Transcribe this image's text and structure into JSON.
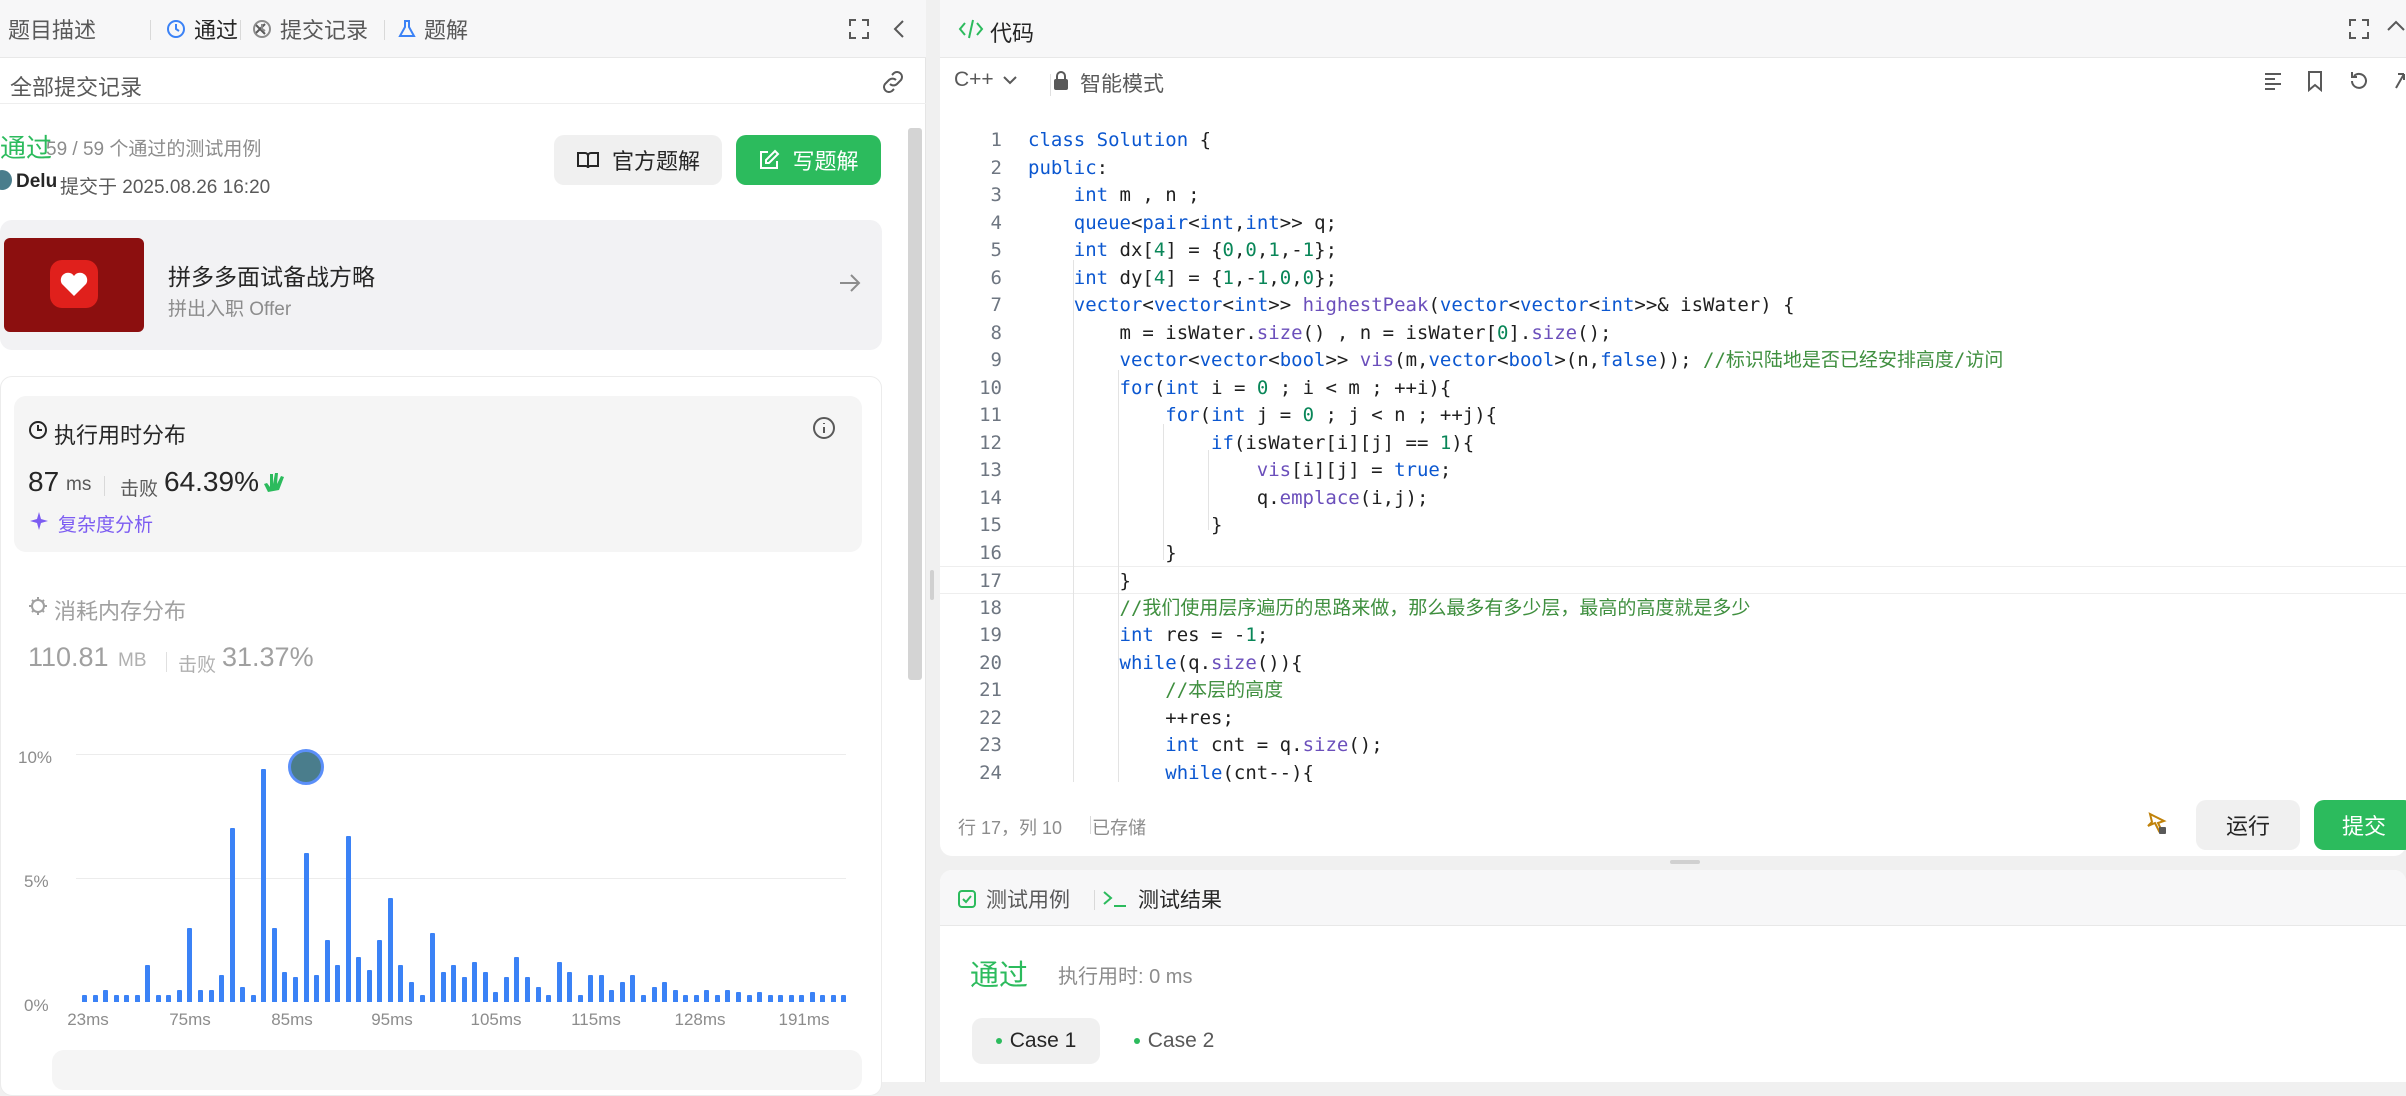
{
  "left_tabs": {
    "description": "题目描述",
    "accepted": "通过",
    "submissions": "提交记录",
    "solutions": "题解"
  },
  "sub_header": {
    "title": "全部提交记录"
  },
  "result": {
    "status": "通过",
    "cases": "59 / 59 个通过的测试用例",
    "user": "Delu",
    "submitted_at": "提交于 2025.08.26 16:20",
    "official_btn": "官方题解",
    "write_btn": "写题解"
  },
  "promo": {
    "title": "拼多多面试备战方略",
    "subtitle": "拼出入职 Offer"
  },
  "runtime": {
    "title": "执行用时分布",
    "value": "87",
    "unit": "ms",
    "beats_label": "击败",
    "beats": "64.39%",
    "complexity": "复杂度分析"
  },
  "memory": {
    "title": "消耗内存分布",
    "value": "110.81",
    "unit": "MB",
    "beats_label": "击败",
    "beats": "31.37%"
  },
  "chart_data": {
    "type": "bar",
    "ylabels": [
      "10%",
      "5%",
      "0%"
    ],
    "ylim": [
      0,
      10
    ],
    "xlabels": [
      "23ms",
      "75ms",
      "85ms",
      "95ms",
      "105ms",
      "115ms",
      "128ms",
      "191ms"
    ],
    "values": [
      0.3,
      0.3,
      0.5,
      0.3,
      0.3,
      0.3,
      1.5,
      0.3,
      0.3,
      0.5,
      3.0,
      0.5,
      0.5,
      1.1,
      7.0,
      0.6,
      0.3,
      9.4,
      3.0,
      1.2,
      1.0,
      6.0,
      1.1,
      2.5,
      1.5,
      6.7,
      1.8,
      1.3,
      2.5,
      4.2,
      1.5,
      0.8,
      0.3,
      2.8,
      1.2,
      1.5,
      1.0,
      1.6,
      1.2,
      0.4,
      1.0,
      1.8,
      1.0,
      0.6,
      0.3,
      1.6,
      1.2,
      0.3,
      1.1,
      1.1,
      0.5,
      0.8,
      1.1,
      0.3,
      0.6,
      0.8,
      0.5,
      0.3,
      0.3,
      0.5,
      0.3,
      0.5,
      0.4,
      0.3,
      0.4,
      0.3,
      0.3,
      0.3,
      0.3,
      0.4,
      0.3,
      0.3,
      0.3
    ],
    "highlight_index": 21,
    "color": "#3b82f6"
  },
  "editor": {
    "title": "代码",
    "language": "C++",
    "mode": "智能模式",
    "status_pos": "行 17，列 10",
    "status_saved": "已存储",
    "run_btn": "运行",
    "submit_btn": "提交",
    "lines": [
      "class Solution {",
      "public:",
      "    int m , n ;",
      "    queue<pair<int,int>> q;",
      "    int dx[4] = {0,0,1,-1};",
      "    int dy[4] = {1,-1,0,0};",
      "    vector<vector<int>> highestPeak(vector<vector<int>>& isWater) {",
      "        m = isWater.size() , n = isWater[0].size();",
      "        vector<vector<bool>> vis(m,vector<bool>(n,false)); //标识陆地是否已经安排高度/访问",
      "        for(int i = 0 ; i < m ; ++i){",
      "            for(int j = 0 ; j < n ; ++j){",
      "                if(isWater[i][j] == 1){",
      "                    vis[i][j] = true;",
      "                    q.emplace(i,j);",
      "                }",
      "            }",
      "        }",
      "        //我们使用层序遍历的思路来做，那么最多有多少层，最高的高度就是多少",
      "        int res = -1;",
      "        while(q.size()){",
      "            //本层的高度",
      "            ++res;",
      "            int cnt = q.size();",
      "            while(cnt--){"
    ]
  },
  "bottom": {
    "tab_cases": "测试用例",
    "tab_results": "测试结果",
    "status": "通过",
    "exec_time": "执行用时: 0 ms",
    "case1": "Case 1",
    "case2": "Case 2"
  },
  "colors": {
    "green": "#2cbb5d",
    "accent_blue": "#3b82f6",
    "link_purple": "#7c5cf2"
  }
}
